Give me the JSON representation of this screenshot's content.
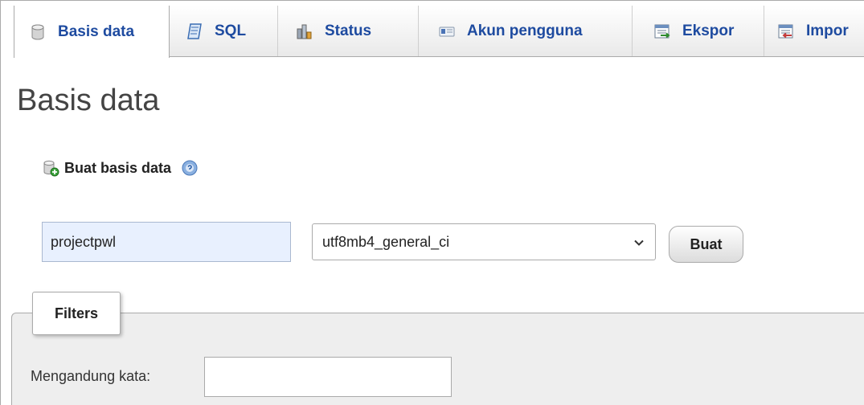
{
  "tabs": [
    {
      "label": "Basis data",
      "icon": "database-icon",
      "active": true
    },
    {
      "label": "SQL",
      "icon": "sql-icon",
      "active": false
    },
    {
      "label": "Status",
      "icon": "status-chart-icon",
      "active": false
    },
    {
      "label": "Akun pengguna",
      "icon": "user-accounts-icon",
      "active": false
    },
    {
      "label": "Ekspor",
      "icon": "export-icon",
      "active": false
    },
    {
      "label": "Impor",
      "icon": "import-icon",
      "active": false
    }
  ],
  "page": {
    "title": "Basis data"
  },
  "create": {
    "heading": "Buat basis data",
    "db_name_value": "projectpwl",
    "collation_value": "utf8mb4_general_ci",
    "button_label": "Buat"
  },
  "filters": {
    "legend": "Filters",
    "contains_label": "Mengandung kata:",
    "contains_value": ""
  },
  "colors": {
    "link": "#1e4ba0",
    "input_autofill": "#e8f0fe",
    "filter_bg": "#eeeeee"
  }
}
